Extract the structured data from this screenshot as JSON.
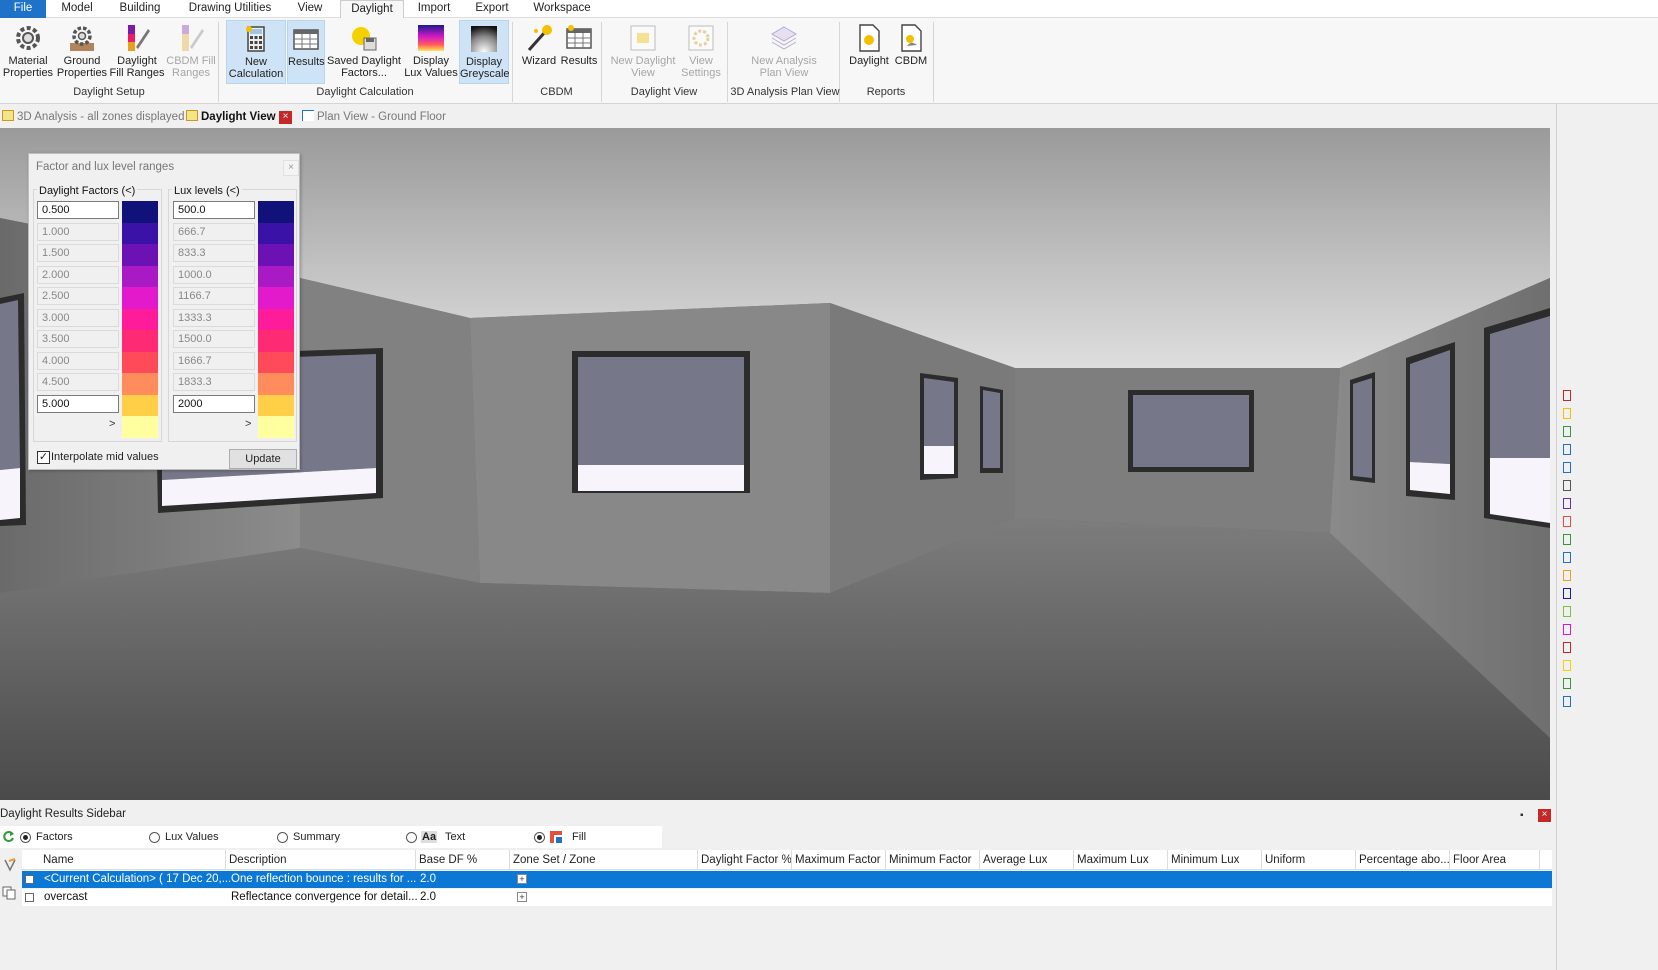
{
  "menu": [
    "File",
    "Model",
    "Building",
    "Drawing Utilities",
    "View",
    "Daylight",
    "Import",
    "Export",
    "Workspace"
  ],
  "ribbon": {
    "buttons": {
      "material": "Material Properties",
      "ground": "Ground Properties",
      "fill_ranges": "Daylight Fill Ranges",
      "cbdm_fill": "CBDM Fill Ranges",
      "new_calc": "New Calculation",
      "results": "Results",
      "saved": "Saved Daylight Factors...",
      "lux": "Display Lux Values",
      "grey": "Display Greyscale",
      "wizard": "Wizard",
      "cbdm_results": "Results",
      "new_view": "New Daylight View",
      "view_settings": "View Settings",
      "new_plan": "New Analysis Plan View",
      "rep_daylight": "Daylight",
      "rep_cbdm": "CBDM"
    },
    "groups": {
      "setup": "Daylight Setup",
      "calc": "Daylight Calculation",
      "cbdm": "CBDM",
      "view": "Daylight View",
      "plan": "3D Analysis Plan View",
      "reports": "Reports"
    }
  },
  "doc_tabs": {
    "analysis": "3D Analysis - all zones displayed",
    "daylight_view": "Daylight View",
    "close": "×",
    "plan": "Plan View - Ground Floor"
  },
  "range_dialog": {
    "title": "Factor and lux level ranges",
    "close": "×",
    "df_header": "Daylight Factors  (<)",
    "lux_header": "Lux levels (<)",
    "df_values": [
      "0.500",
      "1.000",
      "1.500",
      "2.000",
      "2.500",
      "3.000",
      "3.500",
      "4.000",
      "4.500",
      "5.000"
    ],
    "lux_values": [
      "500.0",
      "666.7",
      "833.3",
      "1000.0",
      "1166.7",
      "1333.3",
      "1500.0",
      "1666.7",
      "1833.3",
      "2000"
    ],
    "more": ">",
    "interpolate_check": "✓",
    "interpolate": "Interpolate mid values",
    "update": "Update",
    "colors": [
      "#11117a",
      "#3a12a8",
      "#6c12b4",
      "#a81ac4",
      "#e21acc",
      "#ff1c9a",
      "#ff2a74",
      "#ff4a5a",
      "#ff8c5c",
      "#ffcf48",
      "#ffffa0"
    ]
  },
  "results_sidebar": {
    "title": "Daylight Results Sidebar",
    "pin": "▪",
    "close": "×",
    "options": {
      "factors": "Factors",
      "lux": "Lux Values",
      "summary": "Summary",
      "text_icon": "Aa",
      "text": "Text",
      "fill": "Fill"
    },
    "columns": [
      "Name",
      "Description",
      "Base DF %",
      "Zone Set / Zone",
      "Daylight Factor %",
      "Maximum Factor",
      "Minimum Factor",
      "Average Lux",
      "Maximum Lux",
      "Minimum Lux",
      "Uniform",
      "Percentage abo...",
      "Floor Area"
    ],
    "rows": [
      {
        "name": "<Current Calculation> ( 17 Dec 20,...",
        "description": "One reflection bounce : results for ...",
        "base_df": "2.0",
        "expander": "+"
      },
      {
        "name": "overcast",
        "description": "Reflectance convergence for detail...",
        "base_df": "2.0",
        "expander": "+"
      }
    ]
  }
}
